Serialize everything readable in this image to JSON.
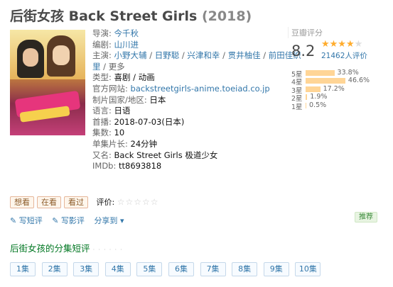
{
  "title": {
    "name": "后街女孩 Back Street Girls",
    "year": "(2018)"
  },
  "info": {
    "director_label": "导演:",
    "director": "今千秋",
    "writer_label": "编剧:",
    "writer": "山川进",
    "cast_label": "主演:",
    "cast": [
      "小野大辅",
      "日野聪",
      "兴津和幸",
      "贯井柚佳",
      "前田佳织"
    ],
    "cast_tail": "里",
    "more": "更多",
    "genre_label": "类型:",
    "genre": "喜剧 / 动画",
    "site_label": "官方网站:",
    "site": "backstreetgirls-anime.toeiad.co.jp",
    "country_label": "制片国家/地区:",
    "country": "日本",
    "lang_label": "语言:",
    "lang": "日语",
    "premiere_label": "首播:",
    "premiere": "2018-07-03(日本)",
    "episodes_label": "集数:",
    "episodes": "10",
    "duration_label": "单集片长:",
    "duration": "24分钟",
    "aka_label": "又名:",
    "aka": "Back Street Girls  极道少女",
    "imdb_label": "IMDb:",
    "imdb": "tt8693818"
  },
  "rating": {
    "label": "豆瓣评分",
    "score": "8.2",
    "votes": "21462人评价",
    "distribution": [
      {
        "label": "5星",
        "pct": "33.8%",
        "value": 33.8
      },
      {
        "label": "4星",
        "pct": "46.6%",
        "value": 46.6
      },
      {
        "label": "3星",
        "pct": "17.2%",
        "value": 17.2
      },
      {
        "label": "2星",
        "pct": "1.9%",
        "value": 1.9
      },
      {
        "label": "1星",
        "pct": "0.5%",
        "value": 0.5
      }
    ]
  },
  "buttons": {
    "want": "想看",
    "watching": "在看",
    "watched": "看过",
    "rate_label": "评价:",
    "rate_stars": "☆☆☆☆☆"
  },
  "actions": {
    "short_review": "写短评",
    "review": "写影评",
    "share": "分享到",
    "share_arrow": "▾",
    "recommend": "推荐"
  },
  "episodes_section": {
    "title": "后街女孩的分集短评",
    "dots": "· · · · · ·",
    "items": [
      "1集",
      "2集",
      "3集",
      "4集",
      "5集",
      "6集",
      "7集",
      "8集",
      "9集",
      "10集"
    ]
  },
  "colors": {
    "link": "#3377aa",
    "green": "#007722",
    "star": "#ffac2d",
    "bar": "#ffd596"
  }
}
